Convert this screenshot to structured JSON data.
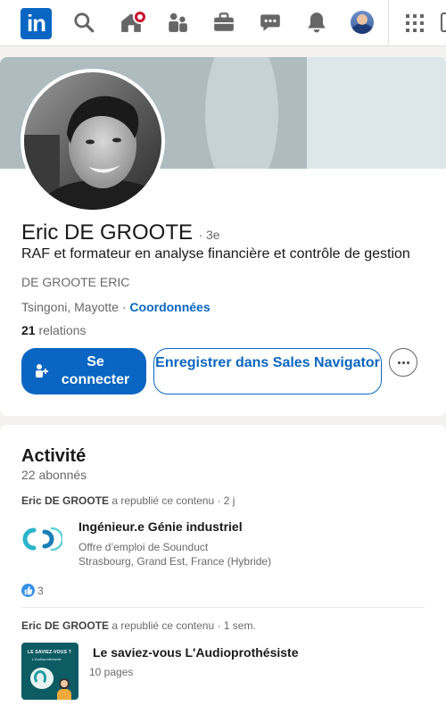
{
  "nav": {
    "logo": "in",
    "icons": [
      "search-icon",
      "home-icon",
      "network-icon",
      "jobs-icon",
      "messaging-icon",
      "notifications-icon",
      "me-avatar",
      "apps-grid-icon"
    ],
    "accent": "#0a66c2",
    "badge_color": "#cb112d"
  },
  "profile": {
    "name": "Eric DE GROOTE",
    "degree": "· 3e",
    "headline": "RAF et formateur en analyse financière et contrôle de gestion",
    "company": "DE GROOTE ERIC",
    "location": "Tsingoni, Mayotte",
    "location_sep": " · ",
    "contact_link": "Coordonnées",
    "relations_count": "21",
    "relations_label": " relations",
    "connect_label": "Se connecter",
    "sales_label": "Enregistrer dans Sales Navigator"
  },
  "activity": {
    "title": "Activité",
    "followers": "22 abonnés",
    "posts": [
      {
        "author": "Eric DE GROOTE",
        "action": " a republié ce contenu · 2 j",
        "title": "Ingénieur.e Génie industriel",
        "line1": "Offre d’emploi de Sounduct",
        "line2": "Strasbourg, Grand Est, France (Hybride)",
        "likes": "3"
      },
      {
        "author": "Eric DE GROOTE",
        "action": " a republié ce contenu · 1 sem.",
        "title": "Le saviez-vous L'Audioprothésiste",
        "line1": "10 pages",
        "thumb_title": "LE SAVIEZ-VOUS ?",
        "thumb_sub": "L'Audioprothésiste"
      }
    ]
  }
}
